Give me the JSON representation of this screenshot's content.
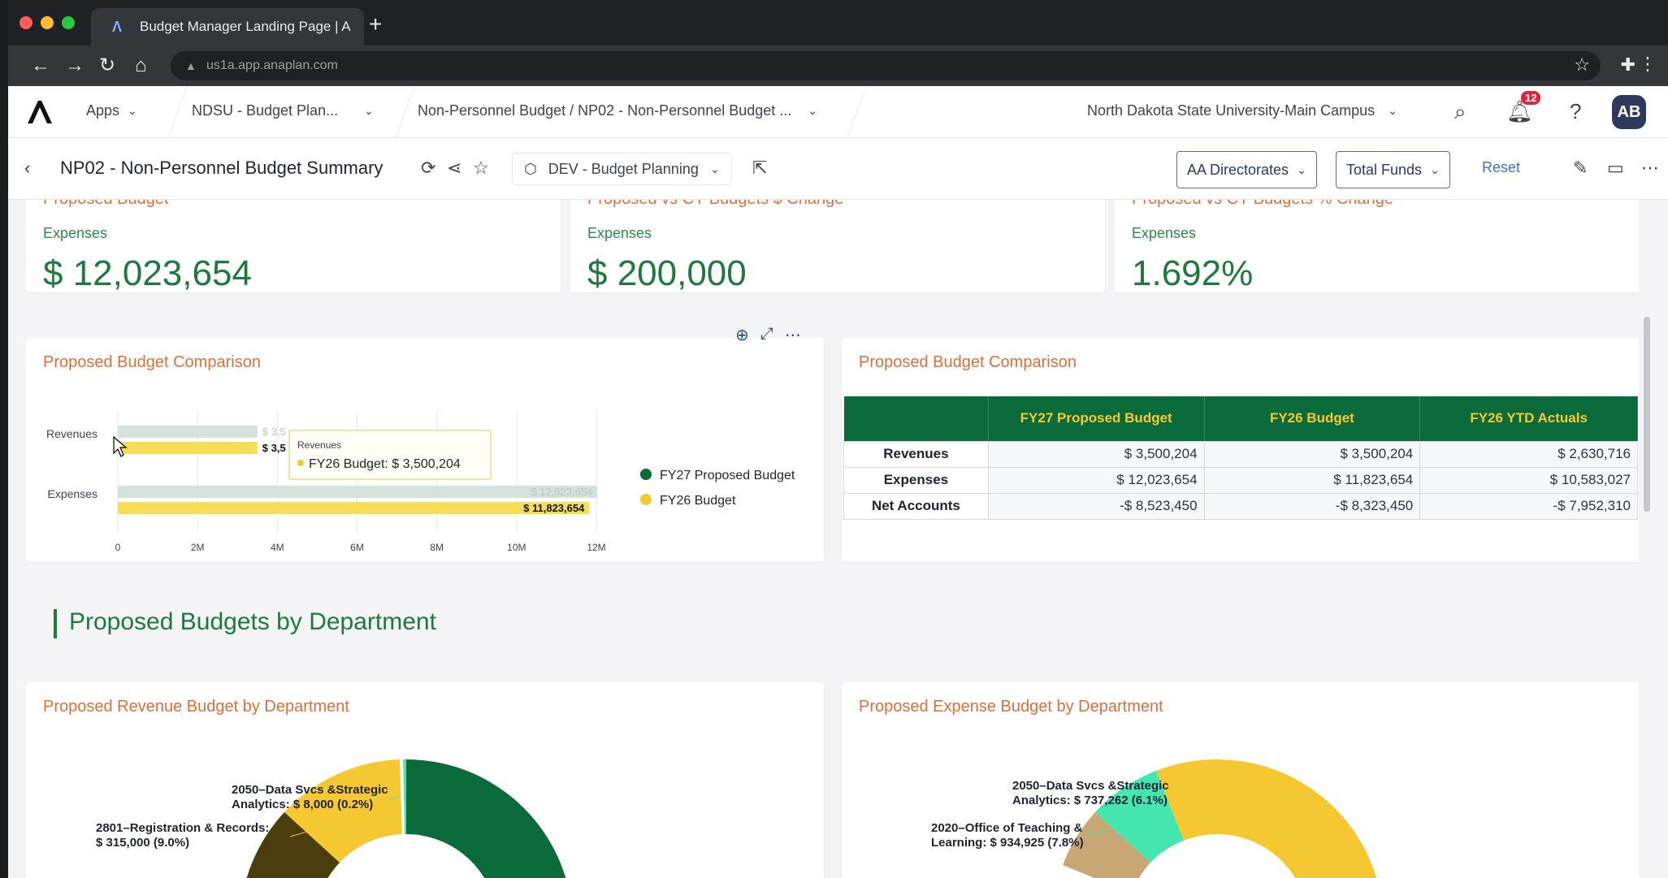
{
  "browser": {
    "tab_title": "Budget Manager Landing Page | A",
    "url": "us1a.app.anaplan.com"
  },
  "header": {
    "apps_label": "Apps",
    "model_label": "NDSU - Budget Plan...",
    "page_path": "Non-Personnel Budget / NP02 - Non-Personnel Budget ...",
    "context_label": "North Dakota State University-Main Campus",
    "notification_count": "12",
    "user_initials": "AB"
  },
  "toolbar": {
    "page_title": "NP02 - Non-Personnel Budget Summary",
    "workspace_label": "DEV - Budget Planning",
    "filter1": "AA Directorates",
    "filter2": "Total Funds",
    "reset_label": "Reset"
  },
  "kpis": [
    {
      "title": "Proposed Budget",
      "sub": "Expenses",
      "value": "$ 12,023,654"
    },
    {
      "title": "Proposed vs CY Budgets $ Change",
      "sub": "Expenses",
      "value": "$ 200,000"
    },
    {
      "title": "Proposed vs CY Budgets % Change",
      "sub": "Expenses",
      "value": "1.692%"
    }
  ],
  "comparison_chart_title": "Proposed Budget Comparison",
  "chart_data": {
    "type": "bar",
    "orientation": "horizontal",
    "categories": [
      "Revenues",
      "Expenses"
    ],
    "series": [
      {
        "name": "FY27 Proposed Budget",
        "color": "#d3e3da",
        "values": [
          3500204,
          12023654
        ],
        "labels": [
          "$ 3,5",
          "$ 12,023,654"
        ]
      },
      {
        "name": "FY26 Budget",
        "color": "#f6df57",
        "values": [
          3500204,
          11823654
        ],
        "labels": [
          "$ 3,5",
          "$ 11,823,654"
        ]
      }
    ],
    "legend_colors": [
      "#0c6b3a",
      "#f5c832"
    ],
    "xlim": [
      0,
      12000000
    ],
    "x_ticks": [
      0,
      2000000,
      4000000,
      6000000,
      8000000,
      10000000,
      12000000
    ],
    "x_tick_labels": [
      "0",
      "2M",
      "4M",
      "6M",
      "8M",
      "10M",
      "12M"
    ],
    "legend_position": "right",
    "tooltip": {
      "category": "Revenues",
      "text": "FY26 Budget: $ 3,500,204"
    }
  },
  "comparison_table": {
    "title": "Proposed Budget Comparison",
    "columns": [
      "",
      "FY27 Proposed Budget",
      "FY26 Budget",
      "FY26 YTD Actuals"
    ],
    "rows": [
      {
        "label": "Revenues",
        "cells": [
          "$ 3,500,204",
          "$ 3,500,204",
          "$ 2,630,716"
        ]
      },
      {
        "label": "Expenses",
        "cells": [
          "$ 12,023,654",
          "$ 11,823,654",
          "$ 10,583,027"
        ]
      },
      {
        "label": "Net Accounts",
        "cells": [
          "-$ 8,523,450",
          "-$ 8,323,450",
          "-$ 7,952,310"
        ]
      }
    ]
  },
  "section_title": "Proposed Budgets by Department",
  "revenue_donut": {
    "title": "Proposed Revenue Budget by Department",
    "labels": [
      "2050–Data Svcs &Strategic\nAnalytics: $ 8,000 (0.2%)",
      "2801–Registration & Records:\n$ 315,000 (9.0%)"
    ]
  },
  "expense_donut": {
    "title": "Proposed Expense Budget by Department",
    "labels": [
      "2050–Data Svcs &Strategic\nAnalytics: $ 737,262 (6.1%)",
      "2020–Office of Teaching &\nLearning: $ 934,925 (7.8%)"
    ]
  }
}
